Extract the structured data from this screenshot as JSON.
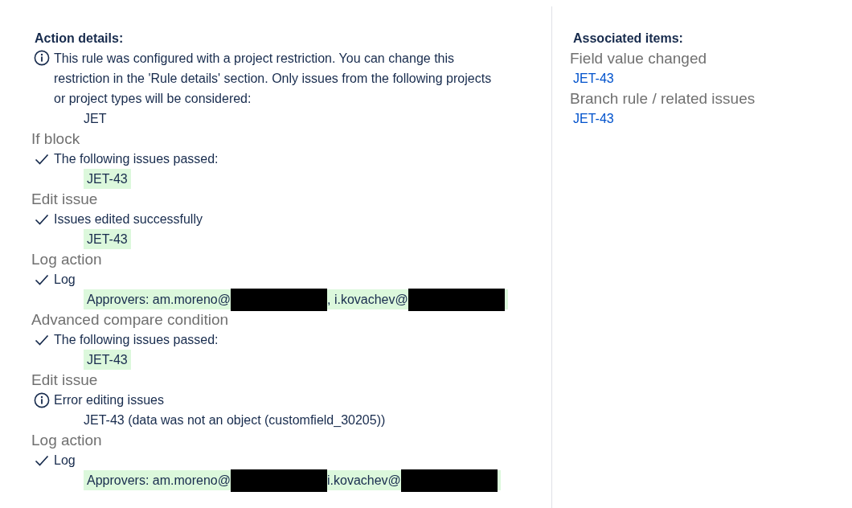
{
  "action_details": {
    "title": "Action details:",
    "message": "This rule was configured with a project restriction. You can change this restriction in the 'Rule details' section. Only issues from the following projects or project types will be considered:",
    "projects": [
      "JET"
    ]
  },
  "sections": [
    {
      "title": "If block",
      "failed": false,
      "message": "The following issues passed:",
      "kind": "issues",
      "issues": [
        "JET-43"
      ]
    },
    {
      "title": "Edit issue",
      "failed": false,
      "message": "Issues edited successfully",
      "kind": "issues",
      "issues": [
        "JET-43"
      ]
    },
    {
      "title": "Log action",
      "failed": false,
      "message": "Log",
      "kind": "log",
      "parts": [
        {
          "kind": "text",
          "text": "Approvers: am.moreno@"
        },
        {
          "kind": "redacted"
        },
        {
          "kind": "text",
          "text": ", i.kovachev@"
        },
        {
          "kind": "redacted"
        }
      ]
    },
    {
      "title": "Advanced compare condition",
      "failed": false,
      "message": "The following issues passed:",
      "kind": "issues",
      "issues": [
        "JET-43"
      ]
    },
    {
      "title": "Edit issue",
      "failed": true,
      "message": "Error editing issues",
      "kind": "detail",
      "detail": "JET-43 (data was not an object (customfield_30205))"
    },
    {
      "title": "Log action",
      "failed": false,
      "message": "Log",
      "kind": "log",
      "parts": [
        {
          "kind": "text",
          "text": "Approvers: am.moreno@"
        },
        {
          "kind": "redacted"
        },
        {
          "kind": "text",
          "text": "i.kovachev@"
        },
        {
          "kind": "redacted"
        }
      ]
    }
  ],
  "associated": {
    "title": "Associated items:",
    "groups": [
      {
        "label": "Field value changed",
        "links": [
          "JET-43"
        ]
      },
      {
        "label": "Branch rule / related issues",
        "links": [
          "JET-43"
        ]
      }
    ]
  }
}
